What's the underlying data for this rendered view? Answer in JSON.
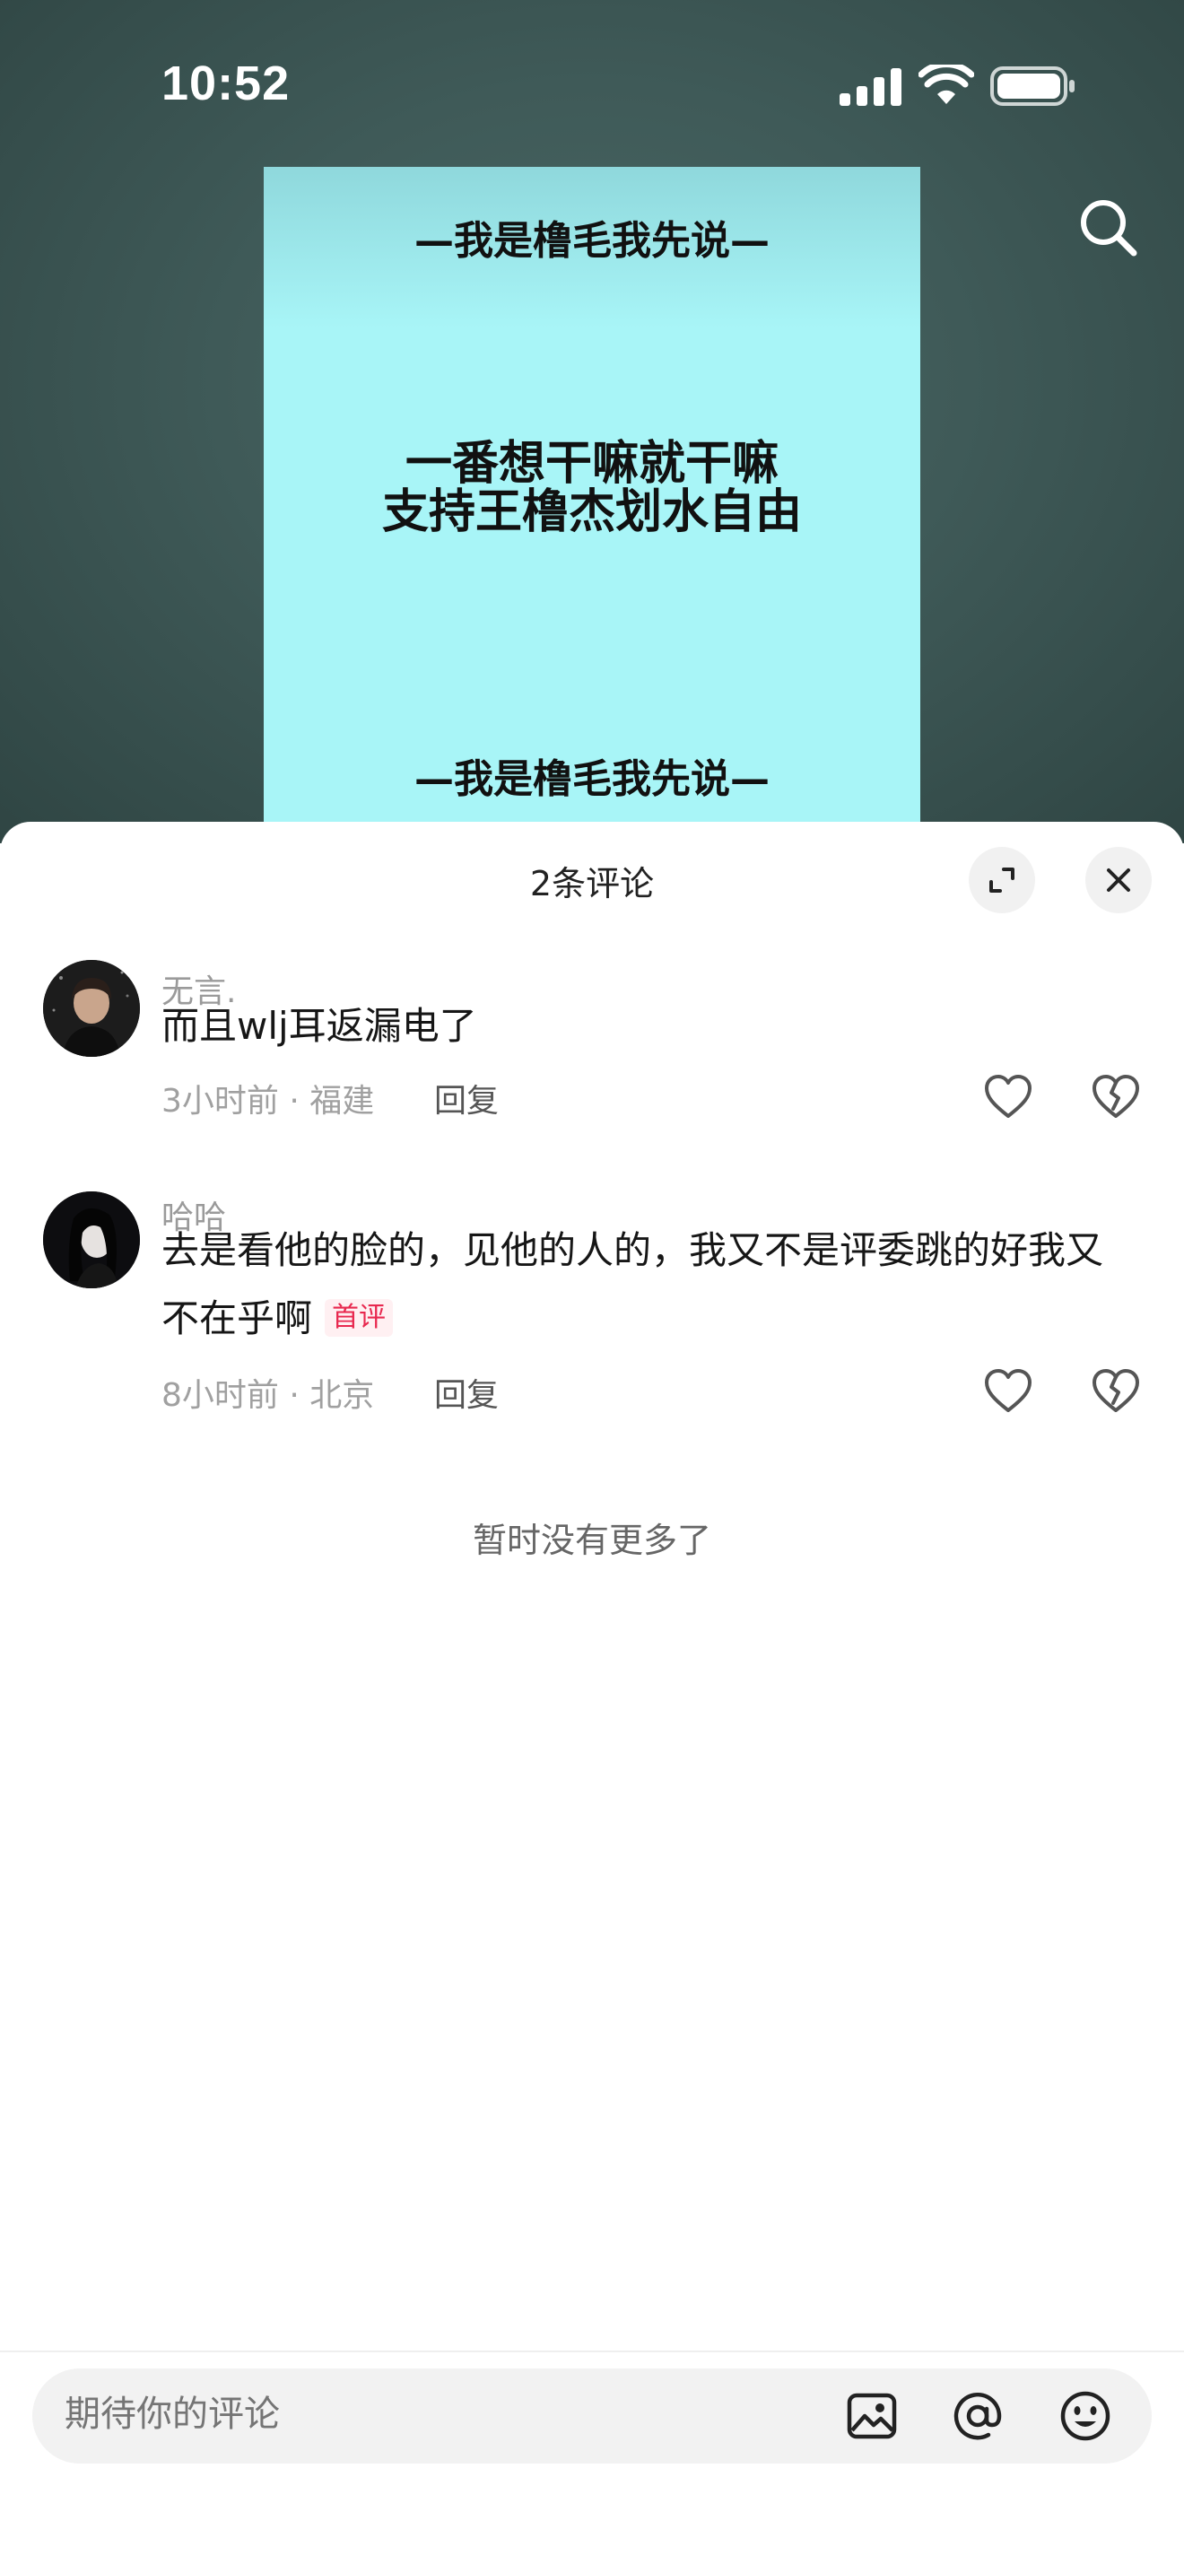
{
  "status_bar": {
    "time": "10:52"
  },
  "poster": {
    "top_line": "—我是橹毛我先说—",
    "main_line_1": "一番想干嘛就干嘛",
    "main_line_2": "支持王橹杰划水自由",
    "bottom_line": "—我是橹毛我先说—",
    "bg_color": "#a8f5f7"
  },
  "sheet": {
    "title": "2条评论",
    "expand_icon": "expand-icon",
    "close_icon": "close-icon"
  },
  "comments": [
    {
      "username": "无言.",
      "text": "而且wlj耳返漏电了",
      "meta": "3小时前 · 福建",
      "reply_label": "回复",
      "badge": ""
    },
    {
      "username": "哈哈",
      "text": "去是看他的脸的，见他的人的，我又不是评委跳的好我又不在乎啊",
      "meta": "8小时前 · 北京",
      "reply_label": "回复",
      "badge": "首评"
    }
  ],
  "footer_note": "暂时没有更多了",
  "input": {
    "placeholder": "期待你的评论",
    "icons": [
      "image-icon",
      "at-icon",
      "emoji-icon"
    ]
  },
  "colors": {
    "accent_badge": "#e8284f",
    "background_top": "#3f5a58"
  }
}
